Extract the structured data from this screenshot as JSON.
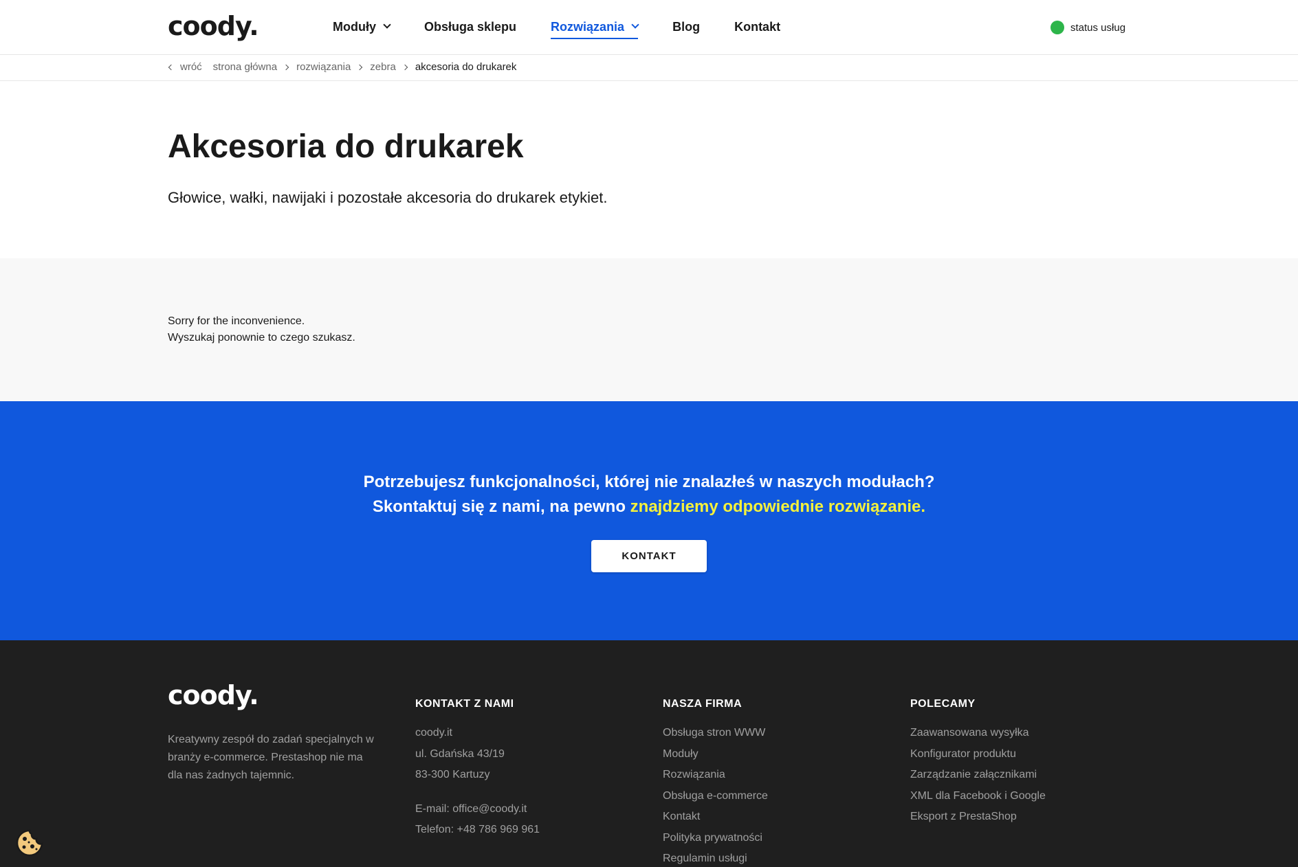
{
  "header": {
    "logo": "coody.",
    "nav": [
      {
        "label": "Moduły",
        "dropdown": true,
        "active": false
      },
      {
        "label": "Obsługa sklepu",
        "dropdown": false,
        "active": false
      },
      {
        "label": "Rozwiązania",
        "dropdown": true,
        "active": true
      },
      {
        "label": "Blog",
        "dropdown": false,
        "active": false
      },
      {
        "label": "Kontakt",
        "dropdown": false,
        "active": false
      }
    ],
    "status_label": "status usług"
  },
  "breadcrumb": {
    "back": "wróć",
    "items": [
      "strona główna",
      "rozwiązania",
      "zebra"
    ],
    "current": "akcesoria do drukarek"
  },
  "hero": {
    "title": "Akcesoria do drukarek",
    "subtitle": "Głowice, wałki, nawijaki i pozostałe akcesoria do drukarek etykiet."
  },
  "message": {
    "line1": "Sorry for the inconvenience.",
    "line2": "Wyszukaj ponownie to czego szukasz."
  },
  "cta": {
    "line1": "Potrzebujesz funkcjonalności, której nie znalazłeś w naszych modułach?",
    "line2_start": "Skontaktuj się z nami, na pewno",
    "line2_highlight": "znajdziemy odpowiednie rozwiązanie.",
    "button": "KONTAKT"
  },
  "footer": {
    "logo": "coody.",
    "description": "Kreatywny zespół do zadań specjalnych w branży e-commerce. Prestashop nie ma dla nas żadnych tajemnic.",
    "contact": {
      "heading": "KONTAKT Z NAMI",
      "company": "coody.it",
      "street": "ul. Gdańska 43/19",
      "city": "83-300 Kartuzy",
      "email": "E-mail: office@coody.it",
      "phone": "Telefon: +48 786 969 961"
    },
    "company": {
      "heading": "NASZA FIRMA",
      "links": [
        "Obsługa stron WWW",
        "Moduły",
        "Rozwiązania",
        "Obsługa e-commerce",
        "Kontakt",
        "Polityka prywatności",
        "Regulamin usługi"
      ]
    },
    "recommended": {
      "heading": "POLECAMY",
      "links": [
        "Zaawansowana wysyłka",
        "Konfigurator produktu",
        "Zarządzanie załącznikami",
        "XML dla Facebook i Google",
        "Eksport z PrestaShop"
      ]
    }
  },
  "colors": {
    "accent": "#1058dd",
    "highlight": "#f4f13c",
    "status_ok": "#2db54a",
    "footer_bg": "#1f1f1f"
  },
  "icons": [
    "chevron-down-icon",
    "chevron-right-icon",
    "chevron-left-icon",
    "status-dot-icon",
    "cookie-icon"
  ]
}
